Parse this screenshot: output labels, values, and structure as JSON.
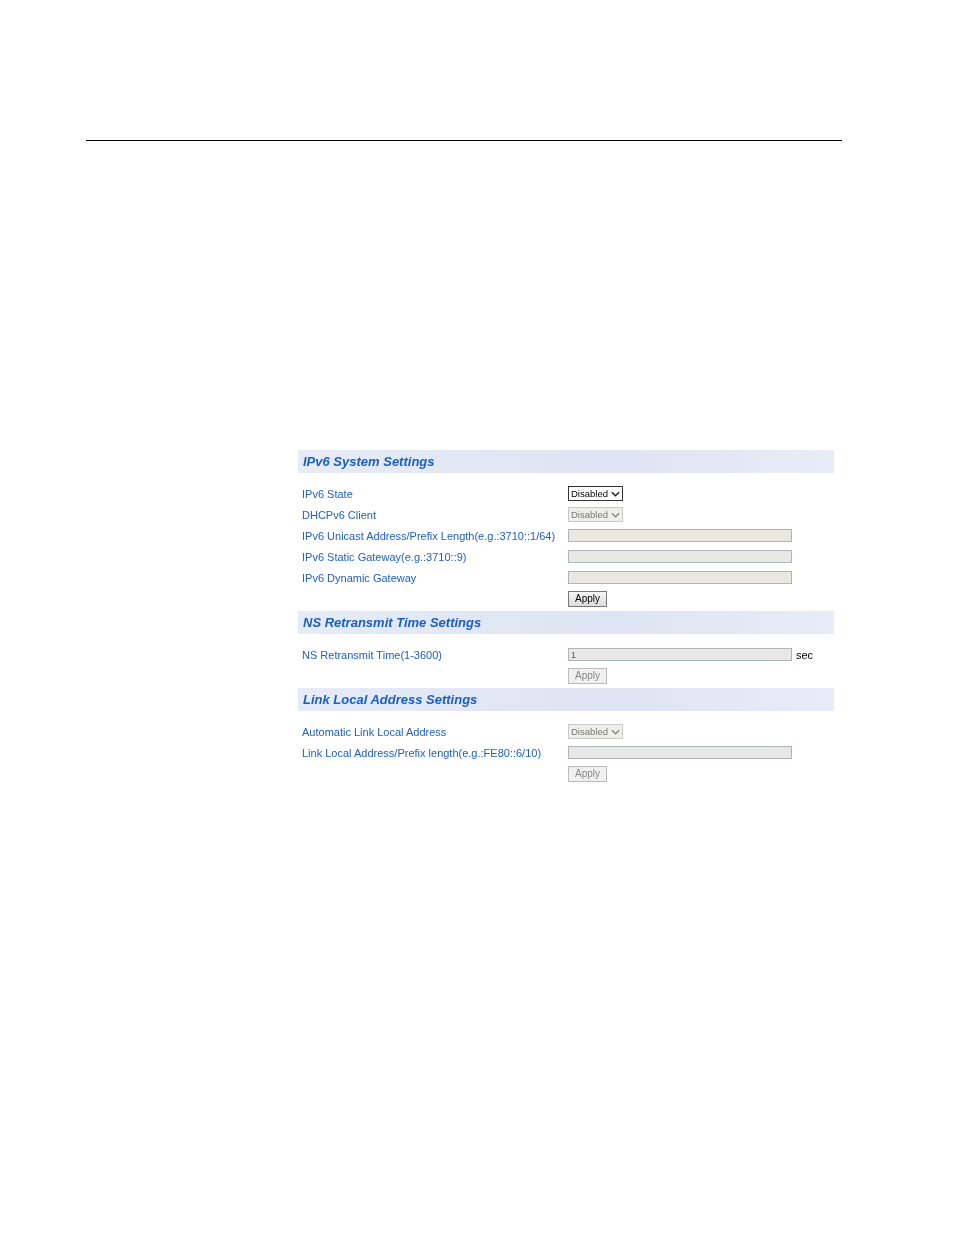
{
  "sections": [
    {
      "title": "IPv6 System Settings",
      "rows": [
        {
          "kind": "select",
          "label": "IPv6 State",
          "value": "Disabled",
          "disabled": false
        },
        {
          "kind": "select",
          "label": "DHCPv6 Client",
          "value": "Disabled",
          "disabled": true
        },
        {
          "kind": "text",
          "label": "IPv6 Unicast Address/Prefix Length(e.g.:3710::1/64)",
          "disabled": true
        },
        {
          "kind": "text",
          "label": "IPv6 Static Gateway(e.g.:3710::9)",
          "disabled": true
        },
        {
          "kind": "text",
          "label": "IPv6 Dynamic Gateway",
          "disabled": true
        }
      ],
      "apply": {
        "label": "Apply",
        "disabled": false
      }
    },
    {
      "title": "NS Retransmit Time Settings",
      "rows": [
        {
          "kind": "text",
          "label": "NS Retransmit Time(1-3600)",
          "value": "1",
          "unit": "sec",
          "disabled": true
        }
      ],
      "apply": {
        "label": "Apply",
        "disabled": true
      }
    },
    {
      "title": "Link Local Address Settings",
      "rows": [
        {
          "kind": "select",
          "label": "Automatic Link Local Address",
          "value": "Disabled",
          "disabled": true
        },
        {
          "kind": "text",
          "label": "Link Local Address/Prefix length(e.g.:FE80::6/10)",
          "disabled": true
        }
      ],
      "apply": {
        "label": "Apply",
        "disabled": true
      }
    }
  ]
}
